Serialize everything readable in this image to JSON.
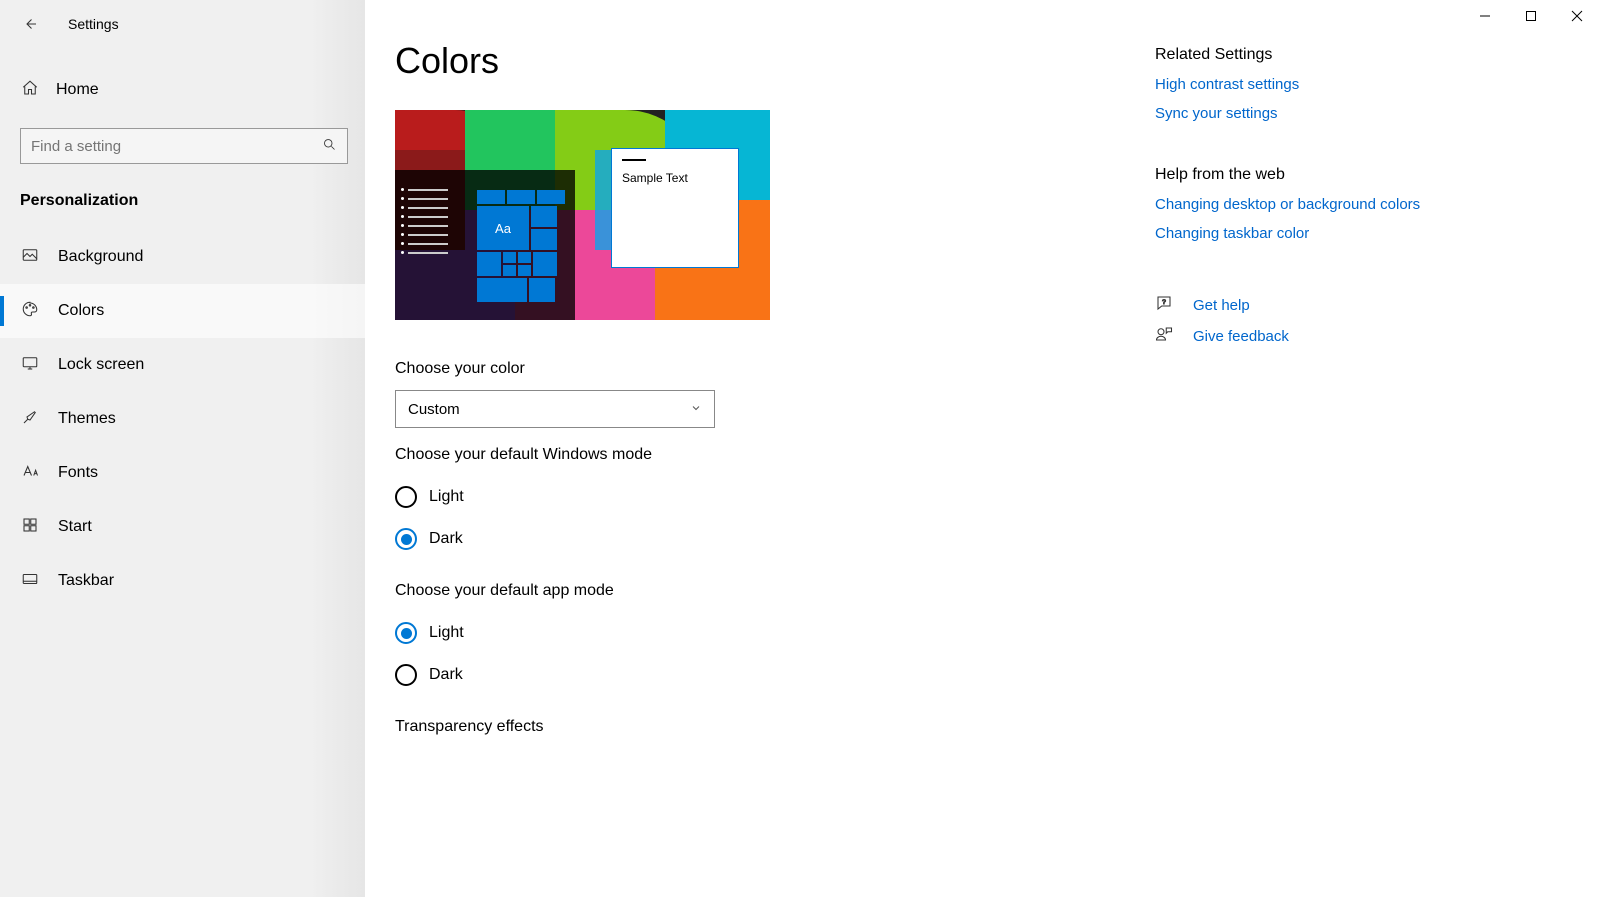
{
  "window": {
    "title": "Settings"
  },
  "sidebar": {
    "home": "Home",
    "search_placeholder": "Find a setting",
    "category": "Personalization",
    "items": [
      {
        "label": "Background"
      },
      {
        "label": "Colors"
      },
      {
        "label": "Lock screen"
      },
      {
        "label": "Themes"
      },
      {
        "label": "Fonts"
      },
      {
        "label": "Start"
      },
      {
        "label": "Taskbar"
      }
    ]
  },
  "main": {
    "title": "Colors",
    "preview_sample": "Sample Text",
    "preview_tile": "Aa",
    "choose_color_label": "Choose your color",
    "choose_color_value": "Custom",
    "windows_mode_label": "Choose your default Windows mode",
    "windows_mode": {
      "light": "Light",
      "dark": "Dark",
      "selected": "dark"
    },
    "app_mode_label": "Choose your default app mode",
    "app_mode": {
      "light": "Light",
      "dark": "Dark",
      "selected": "light"
    },
    "transparency_label": "Transparency effects"
  },
  "side": {
    "related_heading": "Related Settings",
    "related_links": [
      "High contrast settings",
      "Sync your settings"
    ],
    "help_heading": "Help from the web",
    "help_links": [
      "Changing desktop or background colors",
      "Changing taskbar color"
    ],
    "get_help": "Get help",
    "give_feedback": "Give feedback"
  }
}
